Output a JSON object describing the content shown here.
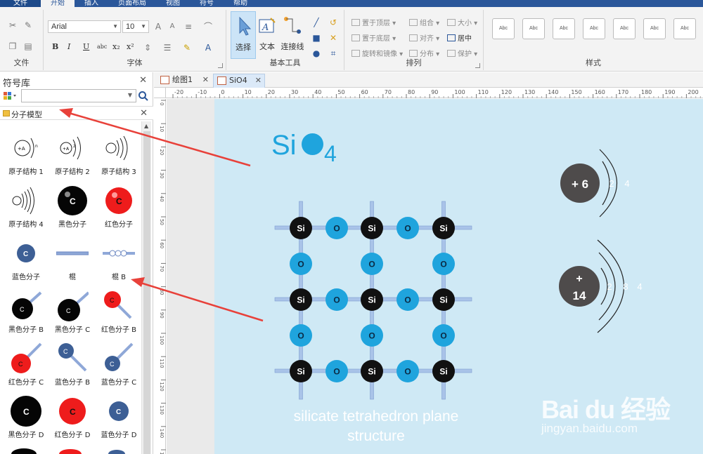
{
  "menu": [
    "文件",
    "开始",
    "插入",
    "页面布局",
    "视图",
    "符号",
    "帮助"
  ],
  "ribbon": {
    "groups": {
      "file": "文件",
      "font": "字体",
      "basic_tools": "基本工具",
      "arrange": "排列",
      "style": "样式"
    },
    "font_name": "Arial",
    "font_size": "10",
    "tools": {
      "select": "选择",
      "text": "文本",
      "connector": "连接线"
    },
    "arrange": {
      "bring_front": "置于顶层",
      "send_back": "置于底层",
      "rotate": "旋转和镜像",
      "group": "组合",
      "align": "对齐",
      "distribute": "分布",
      "size": "大小",
      "center": "居中",
      "protect": "保护"
    },
    "style_label": "Abc"
  },
  "library": {
    "title": "符号库",
    "search_placeholder": "",
    "category": "分子模型",
    "items": [
      {
        "label": "原子结构 1",
        "icon": "atom-structure-1-icon"
      },
      {
        "label": "原子结构 2",
        "icon": "atom-structure-2-icon"
      },
      {
        "label": "原子结构 3",
        "icon": "atom-structure-3-icon"
      },
      {
        "label": "原子结构 4",
        "icon": "atom-structure-4-icon"
      },
      {
        "label": "黑色分子",
        "icon": "black-molecule-icon"
      },
      {
        "label": "红色分子",
        "icon": "red-molecule-icon"
      },
      {
        "label": "蓝色分子",
        "icon": "blue-molecule-icon"
      },
      {
        "label": "棍",
        "icon": "stick-icon"
      },
      {
        "label": "棍 B",
        "icon": "stick-b-icon"
      },
      {
        "label": "黑色分子 B",
        "icon": "black-molecule-b-icon"
      },
      {
        "label": "黑色分子 C",
        "icon": "black-molecule-c-icon"
      },
      {
        "label": "红色分子 B",
        "icon": "red-molecule-b-icon"
      },
      {
        "label": "红色分子 C",
        "icon": "red-molecule-c-icon"
      },
      {
        "label": "蓝色分子 B",
        "icon": "blue-molecule-b-icon"
      },
      {
        "label": "蓝色分子 C",
        "icon": "blue-molecule-c-icon"
      },
      {
        "label": "黑色分子 D",
        "icon": "black-molecule-d-icon"
      },
      {
        "label": "红色分子 D",
        "icon": "red-molecule-d-icon"
      },
      {
        "label": "蓝色分子 D",
        "icon": "blue-molecule-d-icon"
      }
    ],
    "atom_glyphs": {
      "plus_a": "+A",
      "n": "n",
      "two": "2",
      "c": "C"
    }
  },
  "tabs": [
    {
      "label": "绘图1",
      "active": false
    },
    {
      "label": "SiO4",
      "active": true
    }
  ],
  "ruler": {
    "h_ticks": [
      "-20",
      "-10",
      "0",
      "10",
      "20",
      "30",
      "40",
      "50",
      "60",
      "70",
      "80",
      "90",
      "100",
      "110",
      "120",
      "130",
      "140",
      "150",
      "160",
      "170",
      "180",
      "190",
      "200"
    ],
    "v_ticks": [
      "0",
      "10",
      "20",
      "30",
      "40",
      "50",
      "60",
      "70",
      "80",
      "90",
      "100",
      "110",
      "120",
      "130",
      "140",
      "150"
    ]
  },
  "diagram": {
    "title_main": "Si",
    "title_sub": "4",
    "atom_si": "Si",
    "atom_o": "O",
    "caption_line1": "silicate tetrahedron plane",
    "caption_line2": "structure",
    "oxygen": {
      "nucleus": "+ 6",
      "shells": [
        "2",
        "4"
      ]
    },
    "silicon": {
      "nucleus_sign": "+",
      "nucleus_value": "14",
      "shells": [
        "2",
        "8",
        "4"
      ]
    }
  },
  "watermark": {
    "main": "Bai du 经验",
    "sub": "jingyan.baidu.com"
  },
  "colors": {
    "ribbon_blue": "#2b579a",
    "canvas": "#cfe9f5",
    "oxygen": "#1fa4dd",
    "silicon": "#111111",
    "bond": "#a9c3e8",
    "annotation_arrow": "#e8413a"
  }
}
